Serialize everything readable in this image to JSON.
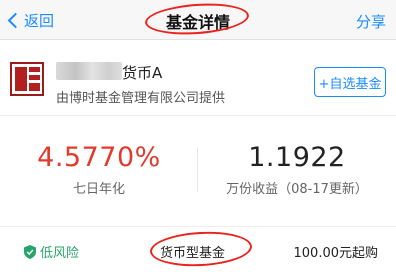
{
  "nav": {
    "back_label": "返回",
    "title": "基金详情",
    "share_label": "分享"
  },
  "fund": {
    "name_suffix": "货币A",
    "provider": "由博时基金管理有限公司提供",
    "add_watchlist_label": "+自选基金"
  },
  "stats": {
    "seven_day_yield": "4.5770%",
    "seven_day_yield_label": "七日年化",
    "per_10k_income": "1.1922",
    "per_10k_income_label": "万份收益（08-17更新）"
  },
  "info": {
    "risk_level": "低风险",
    "fund_type": "货币型基金",
    "min_purchase": "100.00元起购"
  },
  "colors": {
    "accent_blue": "#1a8cff",
    "yield_red": "#e23a2e",
    "risk_green": "#25a56b",
    "annotation_red": "#e8241c",
    "logo_red": "#b31f1f"
  }
}
